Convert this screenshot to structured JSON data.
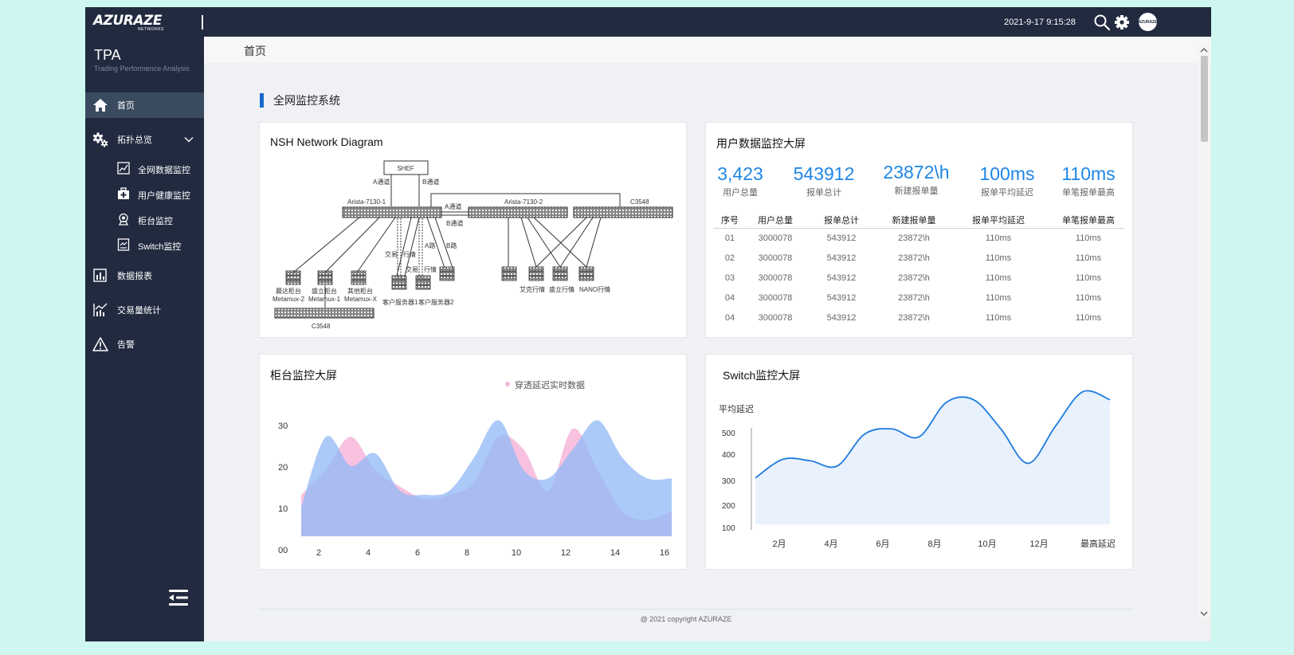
{
  "topbar": {
    "logo": "AZURAZE",
    "logo_sub": "NETWORKS",
    "datetime": "2021-9-17 9:15:28",
    "avatar_text": "AZURAZE"
  },
  "sidebar": {
    "brand_title": "TPA",
    "brand_subtitle": "Trading Performence Analysis",
    "items": [
      {
        "label": "首页",
        "icon": "home-icon"
      },
      {
        "label": "拓扑总览",
        "icon": "gears-icon"
      },
      {
        "label": "数据报表",
        "icon": "bar-chart-icon"
      },
      {
        "label": "交易量统计",
        "icon": "trend-chart-icon"
      },
      {
        "label": "告警",
        "icon": "warning-icon"
      }
    ],
    "sub_items": [
      {
        "label": "全网数据监控",
        "icon": "line-chart-icon"
      },
      {
        "label": "用户健康监控",
        "icon": "medical-kit-icon"
      },
      {
        "label": "柜台监控",
        "icon": "webcam-icon"
      },
      {
        "label": "Switch监控",
        "icon": "monitor-chart-icon"
      }
    ]
  },
  "breadcrumb": "首页",
  "section_title": "全网监控系统",
  "network_card": {
    "title": "NSH Network Diagram",
    "labels": {
      "shef": "SHEF",
      "a_channel": "A通道",
      "b_channel": "B通道",
      "arista1": "Arista-7130-1",
      "arista2": "Arista-7130-2",
      "c3548_top": "C3548",
      "a_channel2": "A通道",
      "b_channel2": "B通道",
      "trade1": "交易",
      "quote1": "行情",
      "a_route": "A路",
      "b_route": "B路",
      "trade2": "交易",
      "quote2": "行情",
      "c1": "晨达柜台",
      "c1b": "Metamux-2",
      "c2": "盛立柜台",
      "c2b": "Metamux-1",
      "c3": "其他柜台",
      "c3b": "Metamux-X",
      "srv1": "客户服务器1",
      "srv2": "客户服务器2",
      "q1": "艾克行情",
      "q2": "盛立行情",
      "q3": "NANO行情",
      "c3548_bottom": "C3548"
    }
  },
  "user_card": {
    "title": "用户数据监控大屏",
    "stats": [
      {
        "value": "3,423",
        "label": "用户总量"
      },
      {
        "value": "543912",
        "label": "报单总计"
      },
      {
        "value": "23872\\h",
        "label": "新建报单量"
      },
      {
        "value": "100ms",
        "label": "报单平均延迟"
      },
      {
        "value": "110ms",
        "label": "单笔报单最高"
      }
    ],
    "columns": [
      "序号",
      "用户总量",
      "报单总计",
      "新建报单量",
      "报单平均延迟",
      "单笔报单最高"
    ],
    "rows": [
      [
        "01",
        "3000078",
        "543912",
        "23872\\h",
        "110ms",
        "110ms"
      ],
      [
        "02",
        "3000078",
        "543912",
        "23872\\h",
        "110ms",
        "110ms"
      ],
      [
        "03",
        "3000078",
        "543912",
        "23872\\h",
        "110ms",
        "110ms"
      ],
      [
        "04",
        "3000078",
        "543912",
        "23872\\h",
        "110ms",
        "110ms"
      ],
      [
        "04",
        "3000078",
        "543912",
        "23872\\h",
        "110ms",
        "110ms"
      ]
    ]
  },
  "counter_card": {
    "title": "柜台监控大屏",
    "legend": "穿透延迟实时数据"
  },
  "switch_card": {
    "title": "Switch监控大屏"
  },
  "chart_data": [
    {
      "type": "area",
      "title": "柜台监控大屏",
      "x": [
        1,
        2,
        3,
        4,
        5,
        6,
        7,
        8,
        9,
        10,
        11,
        12,
        13,
        14,
        15,
        16
      ],
      "xticks": [
        "2",
        "4",
        "6",
        "8",
        "10",
        "12",
        "14",
        "16"
      ],
      "yticks": [
        "00",
        "10",
        "20",
        "30"
      ],
      "ylim": [
        0,
        30
      ],
      "series": [
        {
          "name": "穿透延迟实时数据",
          "color": "#f7b6d9",
          "values": [
            10,
            16,
            24,
            16,
            12,
            9,
            10,
            13,
            24,
            21,
            11,
            26,
            16,
            6,
            4,
            6
          ]
        },
        {
          "values": [
            7,
            24,
            17,
            20,
            11,
            10,
            11,
            19,
            28,
            16,
            14,
            21,
            28,
            19,
            14,
            14
          ],
          "color": "#8fb8f6"
        }
      ],
      "grid": false
    },
    {
      "type": "area",
      "title": "Switch监控大屏",
      "ylabel": "平均延迟",
      "categories": [
        "2月",
        "4月",
        "6月",
        "8月",
        "10月",
        "12月",
        "最高延迟"
      ],
      "yticks": [
        "100",
        "200",
        "300",
        "400",
        "500"
      ],
      "values": [
        275,
        345,
        340,
        320,
        440,
        460,
        430,
        560,
        570,
        460,
        330,
        470,
        600,
        570
      ],
      "color": "#1e7be0",
      "fill": "#e8f1fc",
      "grid": false
    }
  ],
  "footer": "@ 2021 copyright AZURAZE"
}
